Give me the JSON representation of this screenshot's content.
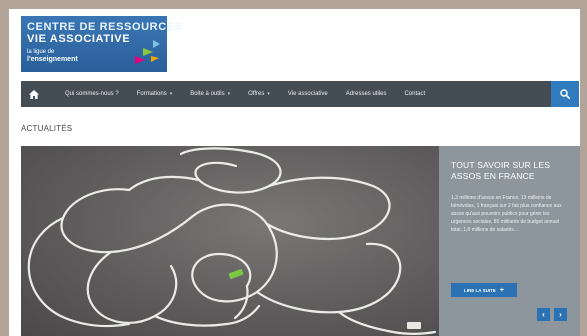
{
  "logo": {
    "line1": "CENTRE DE RESSOURCES",
    "line2": "VIE ASSOCIATIVE",
    "sub1": "la ligue de",
    "sub2": "l'enseignement"
  },
  "nav": {
    "items": [
      {
        "label": "Qui sommes-nous ?",
        "dropdown": false
      },
      {
        "label": "Formations",
        "dropdown": true
      },
      {
        "label": "Boite à outils",
        "dropdown": true
      },
      {
        "label": "Offres",
        "dropdown": true
      },
      {
        "label": "Vie associative",
        "dropdown": false
      },
      {
        "label": "Adresses utiles",
        "dropdown": false
      },
      {
        "label": "Contact",
        "dropdown": false
      }
    ],
    "home_icon": "home-icon",
    "search_icon": "search-icon"
  },
  "section": {
    "title": "ACTUALITÉS"
  },
  "slide": {
    "title": "TOUT SAVOIR SUR LES ASSOS EN FRANCE",
    "text": "1,3 millions d'assos en France, 13 millions de bénévoles, 1 français sur 2 fait plus confiance aux assos qu'aux pouvoirs publics pour gérer les urgences sociales, 85 milliards de budget annuel total, 1,8 millions de salariés…",
    "readmore": "LIRE LA SUITE",
    "prev": "‹",
    "next": "›"
  },
  "colors": {
    "nav_bg": "#454d54",
    "accent": "#2a72b3",
    "panel_bg": "#8c969c"
  }
}
